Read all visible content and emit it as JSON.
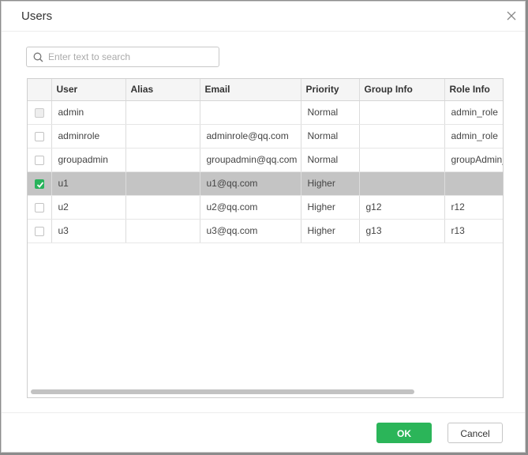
{
  "dialog": {
    "title": "Users"
  },
  "search": {
    "placeholder": "Enter text to search",
    "value": ""
  },
  "table": {
    "columns": [
      "User",
      "Alias",
      "Email",
      "Priority",
      "Group Info",
      "Role Info"
    ],
    "rows": [
      {
        "checked": false,
        "disabled": true,
        "selected": false,
        "cells": [
          "admin",
          "",
          "",
          "Normal",
          "",
          "admin_role"
        ]
      },
      {
        "checked": false,
        "disabled": false,
        "selected": false,
        "cells": [
          "adminrole",
          "",
          "adminrole@qq.com",
          "Normal",
          "",
          "admin_role"
        ]
      },
      {
        "checked": false,
        "disabled": false,
        "selected": false,
        "cells": [
          "groupadmin",
          "",
          "groupadmin@qq.com",
          "Normal",
          "",
          "groupAdmin_"
        ]
      },
      {
        "checked": true,
        "disabled": false,
        "selected": true,
        "cells": [
          "u1",
          "",
          "u1@qq.com",
          "Higher",
          "",
          ""
        ]
      },
      {
        "checked": false,
        "disabled": false,
        "selected": false,
        "cells": [
          "u2",
          "",
          "u2@qq.com",
          "Higher",
          "g12",
          "r12"
        ]
      },
      {
        "checked": false,
        "disabled": false,
        "selected": false,
        "cells": [
          "u3",
          "",
          "u3@qq.com",
          "Higher",
          "g13",
          "r13"
        ]
      }
    ]
  },
  "footer": {
    "ok_label": "OK",
    "cancel_label": "Cancel"
  },
  "colors": {
    "accent": "#2bb559",
    "selected_row": "#c4c4c4"
  }
}
